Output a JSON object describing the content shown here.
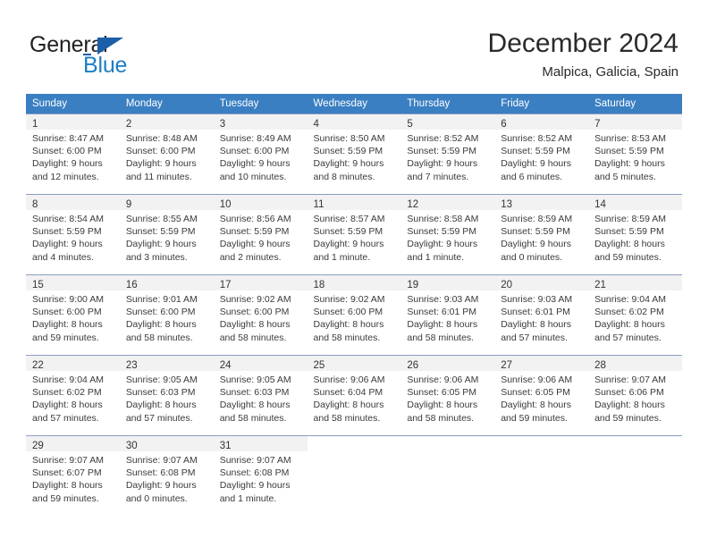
{
  "brand": {
    "word_one": "General",
    "word_two": "Blue",
    "flag_icon": "blue-triangle-flag-icon"
  },
  "header": {
    "month_title": "December 2024",
    "location": "Malpica, Galicia, Spain",
    "header_bg": "#3a7fc2",
    "accent": "#1c7ec4"
  },
  "weekdays": [
    "Sunday",
    "Monday",
    "Tuesday",
    "Wednesday",
    "Thursday",
    "Friday",
    "Saturday"
  ],
  "weeks": [
    [
      {
        "day": "1",
        "sunrise": "Sunrise: 8:47 AM",
        "sunset": "Sunset: 6:00 PM",
        "daylight1": "Daylight: 9 hours",
        "daylight2": "and 12 minutes."
      },
      {
        "day": "2",
        "sunrise": "Sunrise: 8:48 AM",
        "sunset": "Sunset: 6:00 PM",
        "daylight1": "Daylight: 9 hours",
        "daylight2": "and 11 minutes."
      },
      {
        "day": "3",
        "sunrise": "Sunrise: 8:49 AM",
        "sunset": "Sunset: 6:00 PM",
        "daylight1": "Daylight: 9 hours",
        "daylight2": "and 10 minutes."
      },
      {
        "day": "4",
        "sunrise": "Sunrise: 8:50 AM",
        "sunset": "Sunset: 5:59 PM",
        "daylight1": "Daylight: 9 hours",
        "daylight2": "and 8 minutes."
      },
      {
        "day": "5",
        "sunrise": "Sunrise: 8:52 AM",
        "sunset": "Sunset: 5:59 PM",
        "daylight1": "Daylight: 9 hours",
        "daylight2": "and 7 minutes."
      },
      {
        "day": "6",
        "sunrise": "Sunrise: 8:52 AM",
        "sunset": "Sunset: 5:59 PM",
        "daylight1": "Daylight: 9 hours",
        "daylight2": "and 6 minutes."
      },
      {
        "day": "7",
        "sunrise": "Sunrise: 8:53 AM",
        "sunset": "Sunset: 5:59 PM",
        "daylight1": "Daylight: 9 hours",
        "daylight2": "and 5 minutes."
      }
    ],
    [
      {
        "day": "8",
        "sunrise": "Sunrise: 8:54 AM",
        "sunset": "Sunset: 5:59 PM",
        "daylight1": "Daylight: 9 hours",
        "daylight2": "and 4 minutes."
      },
      {
        "day": "9",
        "sunrise": "Sunrise: 8:55 AM",
        "sunset": "Sunset: 5:59 PM",
        "daylight1": "Daylight: 9 hours",
        "daylight2": "and 3 minutes."
      },
      {
        "day": "10",
        "sunrise": "Sunrise: 8:56 AM",
        "sunset": "Sunset: 5:59 PM",
        "daylight1": "Daylight: 9 hours",
        "daylight2": "and 2 minutes."
      },
      {
        "day": "11",
        "sunrise": "Sunrise: 8:57 AM",
        "sunset": "Sunset: 5:59 PM",
        "daylight1": "Daylight: 9 hours",
        "daylight2": "and 1 minute."
      },
      {
        "day": "12",
        "sunrise": "Sunrise: 8:58 AM",
        "sunset": "Sunset: 5:59 PM",
        "daylight1": "Daylight: 9 hours",
        "daylight2": "and 1 minute."
      },
      {
        "day": "13",
        "sunrise": "Sunrise: 8:59 AM",
        "sunset": "Sunset: 5:59 PM",
        "daylight1": "Daylight: 9 hours",
        "daylight2": "and 0 minutes."
      },
      {
        "day": "14",
        "sunrise": "Sunrise: 8:59 AM",
        "sunset": "Sunset: 5:59 PM",
        "daylight1": "Daylight: 8 hours",
        "daylight2": "and 59 minutes."
      }
    ],
    [
      {
        "day": "15",
        "sunrise": "Sunrise: 9:00 AM",
        "sunset": "Sunset: 6:00 PM",
        "daylight1": "Daylight: 8 hours",
        "daylight2": "and 59 minutes."
      },
      {
        "day": "16",
        "sunrise": "Sunrise: 9:01 AM",
        "sunset": "Sunset: 6:00 PM",
        "daylight1": "Daylight: 8 hours",
        "daylight2": "and 58 minutes."
      },
      {
        "day": "17",
        "sunrise": "Sunrise: 9:02 AM",
        "sunset": "Sunset: 6:00 PM",
        "daylight1": "Daylight: 8 hours",
        "daylight2": "and 58 minutes."
      },
      {
        "day": "18",
        "sunrise": "Sunrise: 9:02 AM",
        "sunset": "Sunset: 6:00 PM",
        "daylight1": "Daylight: 8 hours",
        "daylight2": "and 58 minutes."
      },
      {
        "day": "19",
        "sunrise": "Sunrise: 9:03 AM",
        "sunset": "Sunset: 6:01 PM",
        "daylight1": "Daylight: 8 hours",
        "daylight2": "and 58 minutes."
      },
      {
        "day": "20",
        "sunrise": "Sunrise: 9:03 AM",
        "sunset": "Sunset: 6:01 PM",
        "daylight1": "Daylight: 8 hours",
        "daylight2": "and 57 minutes."
      },
      {
        "day": "21",
        "sunrise": "Sunrise: 9:04 AM",
        "sunset": "Sunset: 6:02 PM",
        "daylight1": "Daylight: 8 hours",
        "daylight2": "and 57 minutes."
      }
    ],
    [
      {
        "day": "22",
        "sunrise": "Sunrise: 9:04 AM",
        "sunset": "Sunset: 6:02 PM",
        "daylight1": "Daylight: 8 hours",
        "daylight2": "and 57 minutes."
      },
      {
        "day": "23",
        "sunrise": "Sunrise: 9:05 AM",
        "sunset": "Sunset: 6:03 PM",
        "daylight1": "Daylight: 8 hours",
        "daylight2": "and 57 minutes."
      },
      {
        "day": "24",
        "sunrise": "Sunrise: 9:05 AM",
        "sunset": "Sunset: 6:03 PM",
        "daylight1": "Daylight: 8 hours",
        "daylight2": "and 58 minutes."
      },
      {
        "day": "25",
        "sunrise": "Sunrise: 9:06 AM",
        "sunset": "Sunset: 6:04 PM",
        "daylight1": "Daylight: 8 hours",
        "daylight2": "and 58 minutes."
      },
      {
        "day": "26",
        "sunrise": "Sunrise: 9:06 AM",
        "sunset": "Sunset: 6:05 PM",
        "daylight1": "Daylight: 8 hours",
        "daylight2": "and 58 minutes."
      },
      {
        "day": "27",
        "sunrise": "Sunrise: 9:06 AM",
        "sunset": "Sunset: 6:05 PM",
        "daylight1": "Daylight: 8 hours",
        "daylight2": "and 59 minutes."
      },
      {
        "day": "28",
        "sunrise": "Sunrise: 9:07 AM",
        "sunset": "Sunset: 6:06 PM",
        "daylight1": "Daylight: 8 hours",
        "daylight2": "and 59 minutes."
      }
    ],
    [
      {
        "day": "29",
        "sunrise": "Sunrise: 9:07 AM",
        "sunset": "Sunset: 6:07 PM",
        "daylight1": "Daylight: 8 hours",
        "daylight2": "and 59 minutes."
      },
      {
        "day": "30",
        "sunrise": "Sunrise: 9:07 AM",
        "sunset": "Sunset: 6:08 PM",
        "daylight1": "Daylight: 9 hours",
        "daylight2": "and 0 minutes."
      },
      {
        "day": "31",
        "sunrise": "Sunrise: 9:07 AM",
        "sunset": "Sunset: 6:08 PM",
        "daylight1": "Daylight: 9 hours",
        "daylight2": "and 1 minute."
      },
      {
        "day": "",
        "sunrise": "",
        "sunset": "",
        "daylight1": "",
        "daylight2": ""
      },
      {
        "day": "",
        "sunrise": "",
        "sunset": "",
        "daylight1": "",
        "daylight2": ""
      },
      {
        "day": "",
        "sunrise": "",
        "sunset": "",
        "daylight1": "",
        "daylight2": ""
      },
      {
        "day": "",
        "sunrise": "",
        "sunset": "",
        "daylight1": "",
        "daylight2": ""
      }
    ]
  ]
}
